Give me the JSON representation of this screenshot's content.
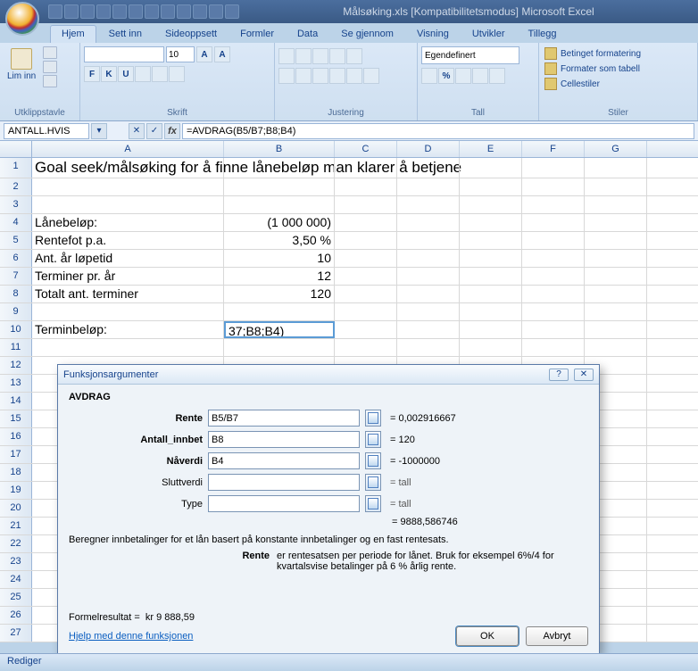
{
  "title": "Målsøking.xls  [Kompatibilitetsmodus]    Microsoft Excel",
  "tabs": [
    "Hjem",
    "Sett inn",
    "Sideoppsett",
    "Formler",
    "Data",
    "Se gjennom",
    "Visning",
    "Utvikler",
    "Tillegg"
  ],
  "ribbon": {
    "clipboard": {
      "label": "Utklippstavle",
      "paste": "Lim inn"
    },
    "font": {
      "label": "Skrift",
      "size": "10",
      "bold": "F",
      "italic": "K",
      "underline": "U"
    },
    "align": {
      "label": "Justering"
    },
    "number": {
      "label": "Tall",
      "format": "Egendefinert"
    },
    "styles": {
      "label": "Stiler",
      "cond": "Betinget formatering",
      "table": "Formater som tabell",
      "cell": "Cellestiler"
    }
  },
  "namebox": "ANTALL.HVIS",
  "formula": "=AVDRAG(B5/B7;B8;B4)",
  "cols": [
    "A",
    "B",
    "C",
    "D",
    "E",
    "F",
    "G"
  ],
  "rows": {
    "r1": {
      "A": "Goal seek/målsøking for å finne lånebeløp man klarer å betjene"
    },
    "r4": {
      "A": "Lånebeløp:",
      "B": "(1 000 000)"
    },
    "r5": {
      "A": "Rentefot p.a.",
      "B": "3,50 %"
    },
    "r6": {
      "A": "Ant. år løpetid",
      "B": "10"
    },
    "r7": {
      "A": "Terminer pr. år",
      "B": "12"
    },
    "r8": {
      "A": "Totalt ant. terminer",
      "B": "120"
    },
    "r10": {
      "A": "Terminbeløp:",
      "B": "37;B8;B4)"
    }
  },
  "dialog": {
    "title": "Funksjonsargumenter",
    "fn": "AVDRAG",
    "args": [
      {
        "label": "Rente",
        "val": "B5/B7",
        "res": "0,002916667",
        "req": true
      },
      {
        "label": "Antall_innbet",
        "val": "B8",
        "res": "120",
        "req": true
      },
      {
        "label": "Nåverdi",
        "val": "B4",
        "res": "-1000000",
        "req": true
      },
      {
        "label": "Sluttverdi",
        "val": "",
        "res": "tall",
        "req": false
      },
      {
        "label": "Type",
        "val": "",
        "res": "tall",
        "req": false
      }
    ],
    "calc": "9888,586746",
    "desc": "Beregner innbetalinger for et lån basert på konstante innbetalinger og en fast rentesats.",
    "param_name": "Rente",
    "param_desc": "er rentesatsen per periode for lånet. Bruk for eksempel 6%/4 for kvartalsvise betalinger på 6 % årlig rente.",
    "result_label": "Formelresultat =",
    "result_val": "kr 9 888,59",
    "help": "Hjelp med denne funksjonen",
    "ok": "OK",
    "cancel": "Avbryt"
  },
  "status": "Rediger"
}
